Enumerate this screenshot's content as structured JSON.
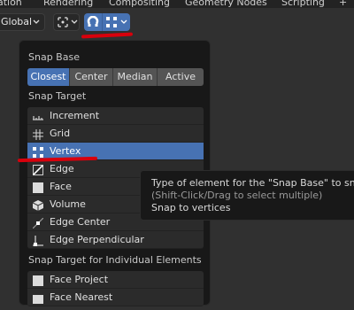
{
  "tabs": [
    "nation",
    "Rendering",
    "Compositing",
    "Geometry Nodes",
    "Scripting",
    "+"
  ],
  "toolbar": {
    "orientation": "Global",
    "icons": [
      "pivot-icon",
      "magnet-icon",
      "vertex-snap-icon",
      "chevron-down-icon"
    ],
    "accent": "#4772b3"
  },
  "popover": {
    "snap_base_label": "Snap Base",
    "snap_base_options": [
      "Closest",
      "Center",
      "Median",
      "Active"
    ],
    "snap_base_selected": "Closest",
    "snap_target_label": "Snap Target",
    "snap_targets": [
      {
        "label": "Increment",
        "icon": "increment-icon"
      },
      {
        "label": "Grid",
        "icon": "grid-icon"
      },
      {
        "label": "Vertex",
        "icon": "vertex-icon"
      },
      {
        "label": "Edge",
        "icon": "edge-icon"
      },
      {
        "label": "Face",
        "icon": "face-icon"
      },
      {
        "label": "Volume",
        "icon": "volume-icon"
      },
      {
        "label": "Edge Center",
        "icon": "edge-center-icon"
      },
      {
        "label": "Edge Perpendicular",
        "icon": "edge-perpendicular-icon"
      }
    ],
    "snap_target_selected": "Vertex",
    "individual_label": "Snap Target for Individual Elements",
    "individual_targets": [
      {
        "label": "Face Project",
        "icon": "face-project-icon"
      },
      {
        "label": "Face Nearest",
        "icon": "face-nearest-icon"
      }
    ]
  },
  "tooltip": {
    "line1": "Type of element for the \"Snap Base\" to snap",
    "line2": "(Shift-Click/Drag to select multiple)",
    "line3": "Snap to vertices"
  },
  "annotation_color": "#d8000c"
}
